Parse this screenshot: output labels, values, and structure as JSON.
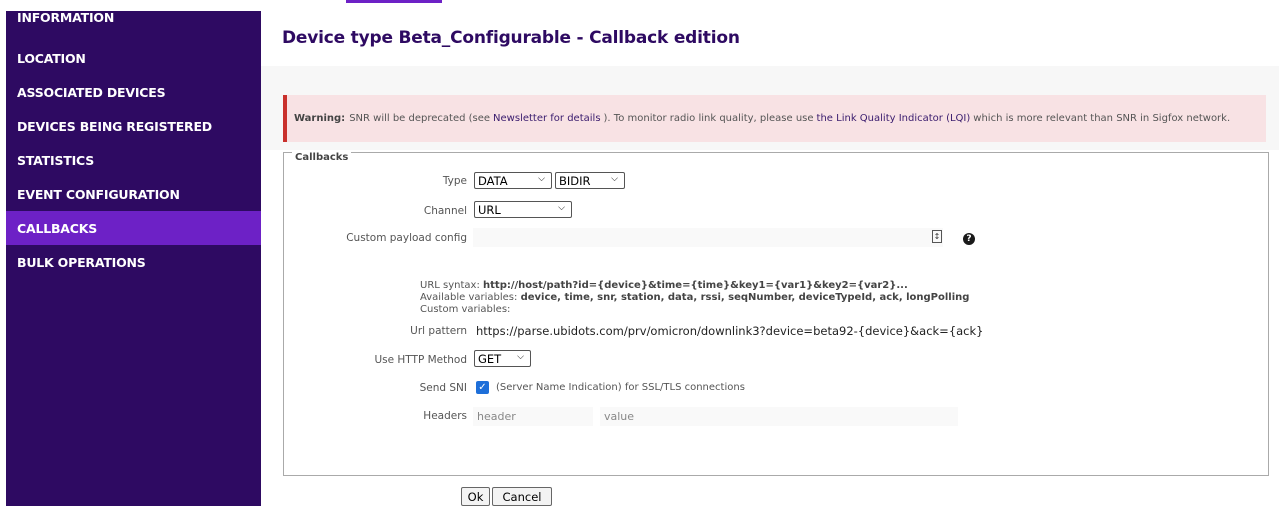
{
  "sidebar": {
    "items": [
      {
        "label": "INFORMATION"
      },
      {
        "label": "LOCATION"
      },
      {
        "label": "ASSOCIATED DEVICES"
      },
      {
        "label": "DEVICES BEING REGISTERED"
      },
      {
        "label": "STATISTICS"
      },
      {
        "label": "EVENT CONFIGURATION"
      },
      {
        "label": "CALLBACKS",
        "active": true
      },
      {
        "label": "BULK OPERATIONS"
      }
    ]
  },
  "header": {
    "title": "Device type Beta_Configurable - Callback edition"
  },
  "warning": {
    "bold": "Warning:",
    "text1": "SNR will be deprecated (see",
    "link1": "Newsletter for details",
    "text2": "). To monitor radio link quality, please use",
    "link2": "the Link Quality Indicator (LQI)",
    "text3": "which is more relevant than SNR in Sigfox network."
  },
  "form": {
    "legend": "Callbacks",
    "type_label": "Type",
    "type_value": "DATA",
    "direction_value": "BIDIR",
    "channel_label": "Channel",
    "channel_value": "URL",
    "payload_label": "Custom payload config",
    "url_syntax_label": "URL syntax:",
    "url_syntax_value": "http://host/path?id={device}&time={time}&key1={var1}&key2={var2}...",
    "available_label": "Available variables:",
    "available_value": "device, time, snr, station, data, rssi, seqNumber, deviceTypeId, ack, longPolling",
    "custom_label": "Custom variables:",
    "url_pattern_label": "Url pattern",
    "url_pattern_value": "https://parse.ubidots.com/prv/omicron/downlink3?device=beta92-{device}&ack={ack}",
    "method_label": "Use HTTP Method",
    "method_value": "GET",
    "sni_label": "Send SNI",
    "sni_checked": true,
    "sni_text": "(Server Name Indication) for SSL/TLS connections",
    "headers_label": "Headers",
    "header_placeholder": "header",
    "value_placeholder": "value"
  },
  "buttons": {
    "ok": "Ok",
    "cancel": "Cancel"
  },
  "colors": {
    "sidebar": "#2e0a62",
    "active": "#6d21c6",
    "warning_bg": "#f8e2e4",
    "warning_border": "#c9302c",
    "check": "#1e6fd9"
  }
}
